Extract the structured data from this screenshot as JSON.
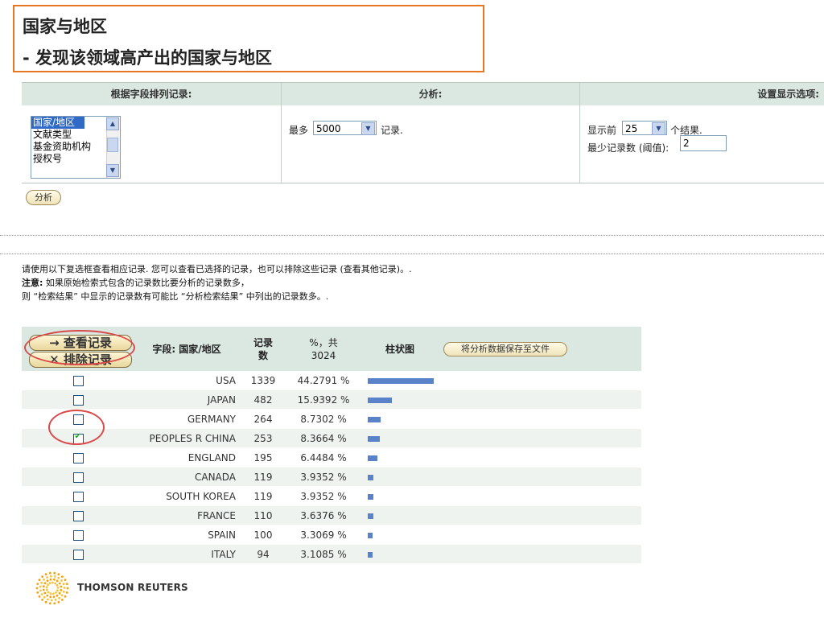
{
  "title": {
    "line1": "国家与地区",
    "line2": "- 发现该领域高产出的国家与地区",
    "border_color": "#e87722"
  },
  "options": {
    "sort_header": "根据字段排列记录:",
    "analyze_header": "分析:",
    "display_header": "设置显示选项:",
    "field_list": [
      "国家/地区",
      "文献类型",
      "基金资助机构",
      "授权号"
    ],
    "field_selected": "国家/地区",
    "max_prefix": "最多",
    "max_value": "5000",
    "max_suffix": "记录.",
    "show_prefix": "显示前",
    "show_value": "25",
    "show_suffix": "个结果.",
    "threshold_label": "最少记录数 (阈值):",
    "threshold_value": "2"
  },
  "analyze_button": "分析",
  "notes": {
    "line1": "请使用以下复选框查看相应记录. 您可以查看已选择的记录，也可以排除这些记录 (查看其他记录)。.",
    "line2_bold": "注意:",
    "line2": " 如果原始检索式包含的记录数比要分析的记录数多，",
    "line3": "则 “检索结果” 中显示的记录数有可能比 “分析检索结果” 中列出的记录数多。."
  },
  "results": {
    "view_button": "→ 查看记录",
    "exclude_button": "✕ 排除记录",
    "col_field": "字段: 国家/地区",
    "col_count": "记录数",
    "col_percent": "%，共 3024",
    "col_bar": "柱状图",
    "save_button": "将分析数据保存至文件",
    "rows": [
      {
        "field": "USA",
        "count": "1339",
        "percent": "44.2791 %",
        "pct": 44.2791,
        "checked": false
      },
      {
        "field": "JAPAN",
        "count": "482",
        "percent": "15.9392 %",
        "pct": 15.9392,
        "checked": false
      },
      {
        "field": "GERMANY",
        "count": "264",
        "percent": "8.7302 %",
        "pct": 8.7302,
        "checked": false
      },
      {
        "field": "PEOPLES R CHINA",
        "count": "253",
        "percent": "8.3664 %",
        "pct": 8.3664,
        "checked": true
      },
      {
        "field": "ENGLAND",
        "count": "195",
        "percent": "6.4484 %",
        "pct": 6.4484,
        "checked": false
      },
      {
        "field": "CANADA",
        "count": "119",
        "percent": "3.9352 %",
        "pct": 3.9352,
        "checked": false
      },
      {
        "field": "SOUTH KOREA",
        "count": "119",
        "percent": "3.9352 %",
        "pct": 3.9352,
        "checked": false
      },
      {
        "field": "FRANCE",
        "count": "110",
        "percent": "3.6376 %",
        "pct": 3.6376,
        "checked": false
      },
      {
        "field": "SPAIN",
        "count": "100",
        "percent": "3.3069 %",
        "pct": 3.3069,
        "checked": false
      },
      {
        "field": "ITALY",
        "count": "94",
        "percent": "3.1085 %",
        "pct": 3.1085,
        "checked": false
      }
    ]
  },
  "logo_text": "THOMSON REUTERS",
  "colors": {
    "bar": "#5a82c8",
    "header_bg": "#dbe8e2",
    "alt_row": "#eef3f0",
    "highlight_ring": "#d94a4a"
  }
}
